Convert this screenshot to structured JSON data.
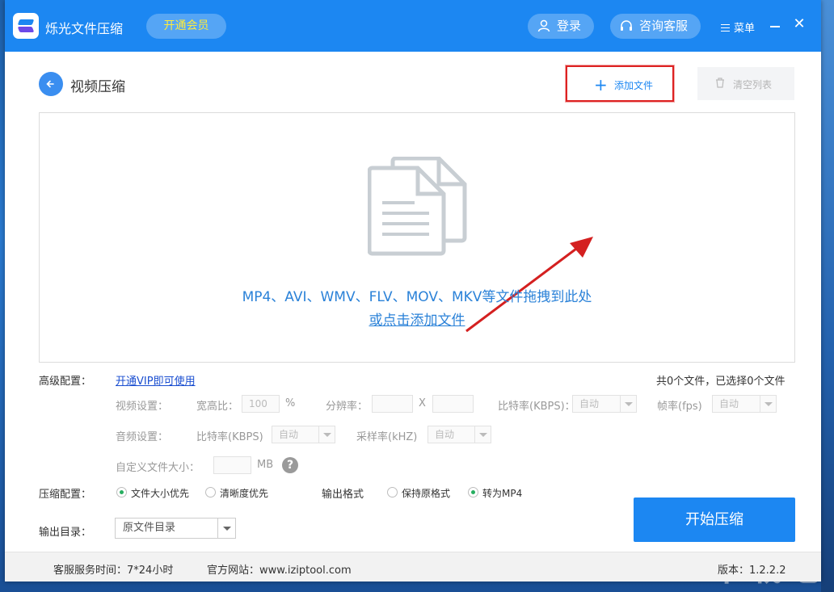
{
  "titlebar": {
    "app_title": "烁光文件压缩",
    "vip_label": "开通会员",
    "login_label": "登录",
    "service_label": "咨询客服",
    "menu_label": "菜单"
  },
  "page": {
    "title": "视频压缩",
    "add_file_label": "添加文件",
    "clear_list_label": "清空列表"
  },
  "drop_zone": {
    "hint": "MP4、AVI、WMV、FLV、MOV、MKV等文件拖拽到此处",
    "link": "或点击添加文件"
  },
  "advanced": {
    "label": "高级配置：",
    "vip_link": "开通VIP即可使用",
    "file_count": "共0个文件，已选择0个文件",
    "video": {
      "label": "视频设置：",
      "aspect_label": "宽高比：",
      "aspect_value": "100",
      "aspect_unit": "%",
      "resolution_label": "分辨率：",
      "resolution_x": "X",
      "bitrate_label": "比特率(KBPS)：",
      "bitrate_value": "自动",
      "fps_label": "帧率(fps)",
      "fps_value": "自动"
    },
    "audio": {
      "label": "音频设置：",
      "bitrate_label": "比特率(KBPS)",
      "bitrate_value": "自动",
      "sample_label": "采样率(kHZ)",
      "sample_value": "自动"
    },
    "custom_size": {
      "label": "自定义文件大小：",
      "unit": "MB"
    }
  },
  "compress": {
    "label": "压缩配置：",
    "option_size": "文件大小优先",
    "option_clarity": "清晰度优先",
    "selected": "文件大小优先",
    "format_label": "输出格式",
    "format_keep": "保持原格式",
    "format_mp4": "转为MP4",
    "format_selected": "转为MP4"
  },
  "output": {
    "label": "输出目录：",
    "value": "原文件目录"
  },
  "start_label": "开始压缩",
  "footer": {
    "service_time": "客服服务时间：7*24小时",
    "website": "官方网站：www.iziptool.com",
    "version": "版本：1.2.2.2"
  },
  "colors": {
    "primary": "#1c87f2",
    "highlight_box": "#d22222",
    "vip_text": "#ffeb3b",
    "radio_on": "#27ae60"
  }
}
